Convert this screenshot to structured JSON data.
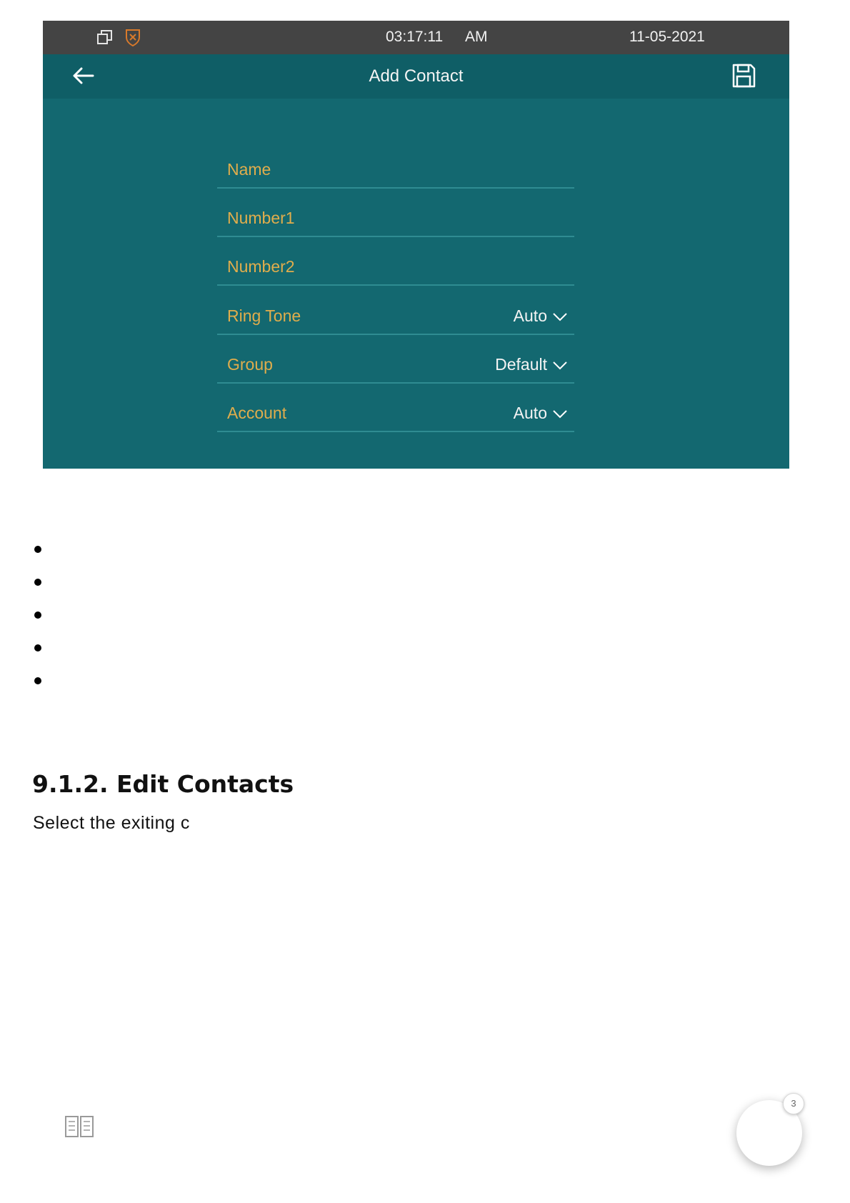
{
  "device": {
    "status_bar": {
      "time": "03:17:11",
      "ampm": "AM",
      "date": "11-05-2021",
      "icons": [
        "window-restore-icon",
        "shield-icon"
      ]
    },
    "title_bar": {
      "title": "Add Contact",
      "back_icon": "arrow-left-icon",
      "save_icon": "save-icon"
    },
    "form": {
      "fields": [
        {
          "label": "Name",
          "value": ""
        },
        {
          "label": "Number1",
          "value": ""
        },
        {
          "label": "Number2",
          "value": ""
        },
        {
          "label": "Ring Tone",
          "value": "Auto"
        },
        {
          "label": "Group",
          "value": "Default"
        },
        {
          "label": "Account",
          "value": "Auto"
        }
      ]
    },
    "colors": {
      "background": "#136870",
      "title_bar": "#0f5e66",
      "status_bar": "#444444",
      "label": "#e0ad4c",
      "divider": "#2f8c92"
    }
  },
  "document": {
    "heading": "9.1.2. Edit Contacts",
    "body": "Select the exiting c"
  },
  "footer": {
    "toc_icon": "book-icon",
    "chat_badge_count": "3"
  }
}
